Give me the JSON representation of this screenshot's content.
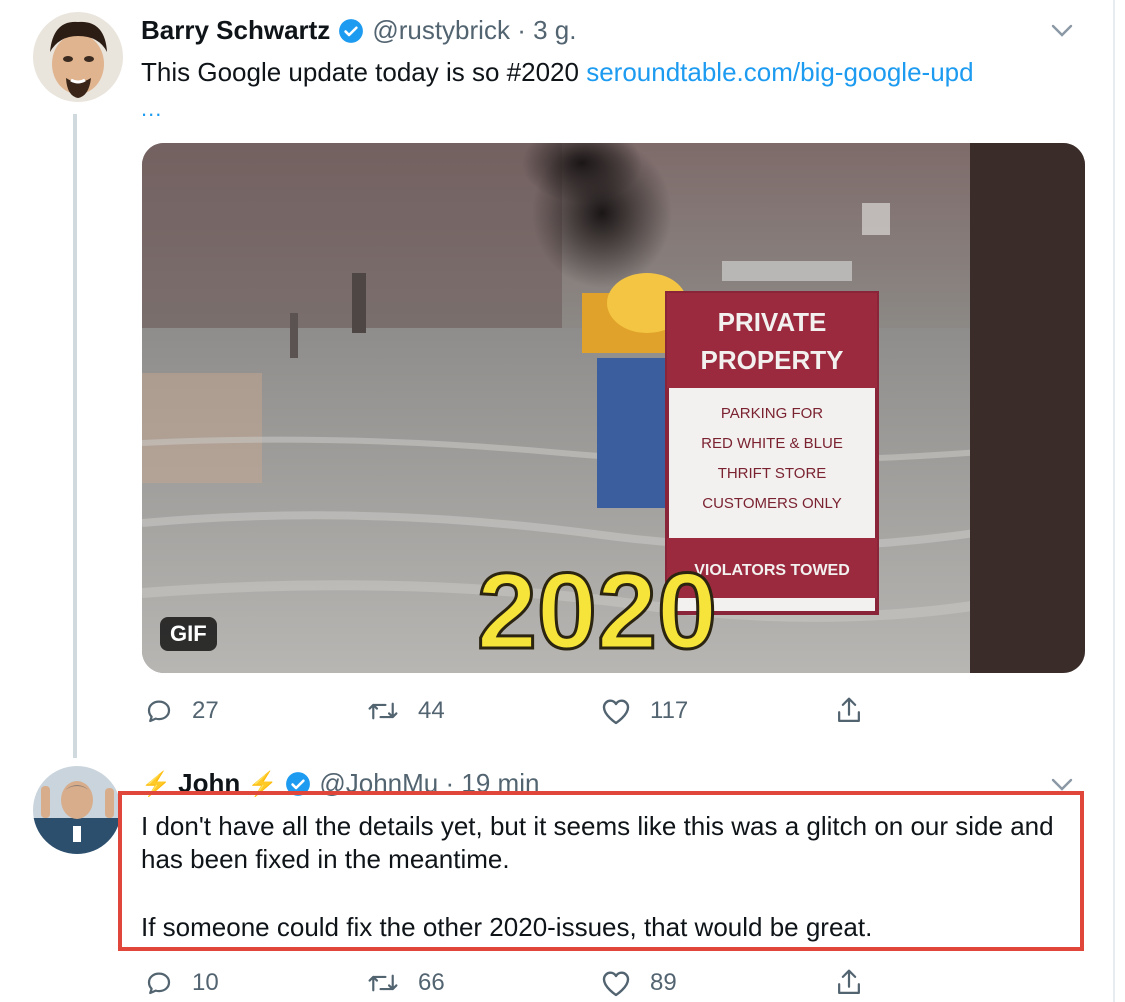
{
  "tweet1": {
    "name": "Barry Schwartz",
    "handle": "@rustybrick",
    "separator": "·",
    "time": "3 g.",
    "text": "This Google update today is so #2020",
    "link": "seroundtable.com/big-google-upd",
    "ellipsis": "...",
    "media": {
      "badge": "GIF",
      "sign_title": [
        "PRIVATE",
        "PROPERTY"
      ],
      "sign_lines": [
        "PARKING FOR",
        "RED WHITE & BLUE",
        "THRIFT STORE",
        "CUSTOMERS ONLY"
      ],
      "sign_footer": "VIOLATORS TOWED",
      "overlay_text": "2020"
    },
    "actions": {
      "replies": "27",
      "retweets": "44",
      "likes": "117"
    }
  },
  "tweet2": {
    "name": "John",
    "handle": "@JohnMu",
    "separator": "·",
    "time": "19 min",
    "paragraph1": "I don't have all the details yet, but it seems like this was a glitch on our side and has been fixed in the meantime.",
    "paragraph2": "If someone could fix the other 2020-issues, that would be great.",
    "actions": {
      "replies": "10",
      "retweets": "66",
      "likes": "89"
    }
  },
  "colors": {
    "link": "#1d9bf0",
    "verified": "#1d9bf0",
    "highlight": "#e0463a",
    "muted": "#536471"
  },
  "icons": [
    "reply-icon",
    "retweet-icon",
    "like-icon",
    "share-icon",
    "verified-badge-icon",
    "chevron-down-icon"
  ]
}
